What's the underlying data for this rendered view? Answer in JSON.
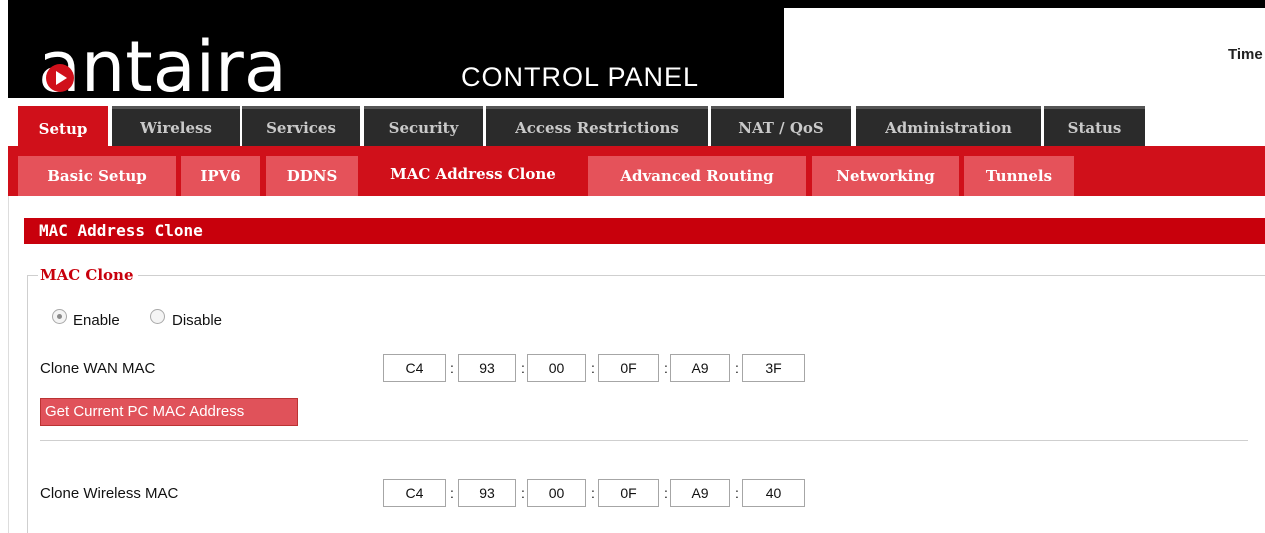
{
  "header": {
    "logo_text": "antaira",
    "panel_title": "CONTROL PANEL",
    "time_label": "Time"
  },
  "main_tabs": [
    {
      "label": "Setup",
      "active": true
    },
    {
      "label": "Wireless",
      "active": false
    },
    {
      "label": "Services",
      "active": false
    },
    {
      "label": "Security",
      "active": false
    },
    {
      "label": "Access Restrictions",
      "active": false
    },
    {
      "label": "NAT / QoS",
      "active": false
    },
    {
      "label": "Administration",
      "active": false
    },
    {
      "label": "Status",
      "active": false
    }
  ],
  "sub_tabs": [
    {
      "label": "Basic Setup",
      "active": false
    },
    {
      "label": "IPV6",
      "active": false
    },
    {
      "label": "DDNS",
      "active": false
    },
    {
      "label": "MAC Address Clone",
      "active": true
    },
    {
      "label": "Advanced Routing",
      "active": false
    },
    {
      "label": "Networking",
      "active": false
    },
    {
      "label": "Tunnels",
      "active": false
    }
  ],
  "section_title": "MAC Address Clone",
  "mac_clone": {
    "legend": "MAC Clone",
    "enable_label": "Enable",
    "disable_label": "Disable",
    "selected": "Enable",
    "wan_label": "Clone WAN MAC",
    "wan_mac": [
      "C4",
      "93",
      "00",
      "0F",
      "A9",
      "3F"
    ],
    "get_mac_button": "Get Current PC MAC Address",
    "wireless_label": "Clone Wireless MAC",
    "wireless_mac": [
      "C4",
      "93",
      "00",
      "0F",
      "A9",
      "40"
    ],
    "separator": ":"
  },
  "colors": {
    "brand_red": "#d0101a",
    "tab_dark": "#2b2b2b",
    "subtab_pink": "#e5525a"
  }
}
